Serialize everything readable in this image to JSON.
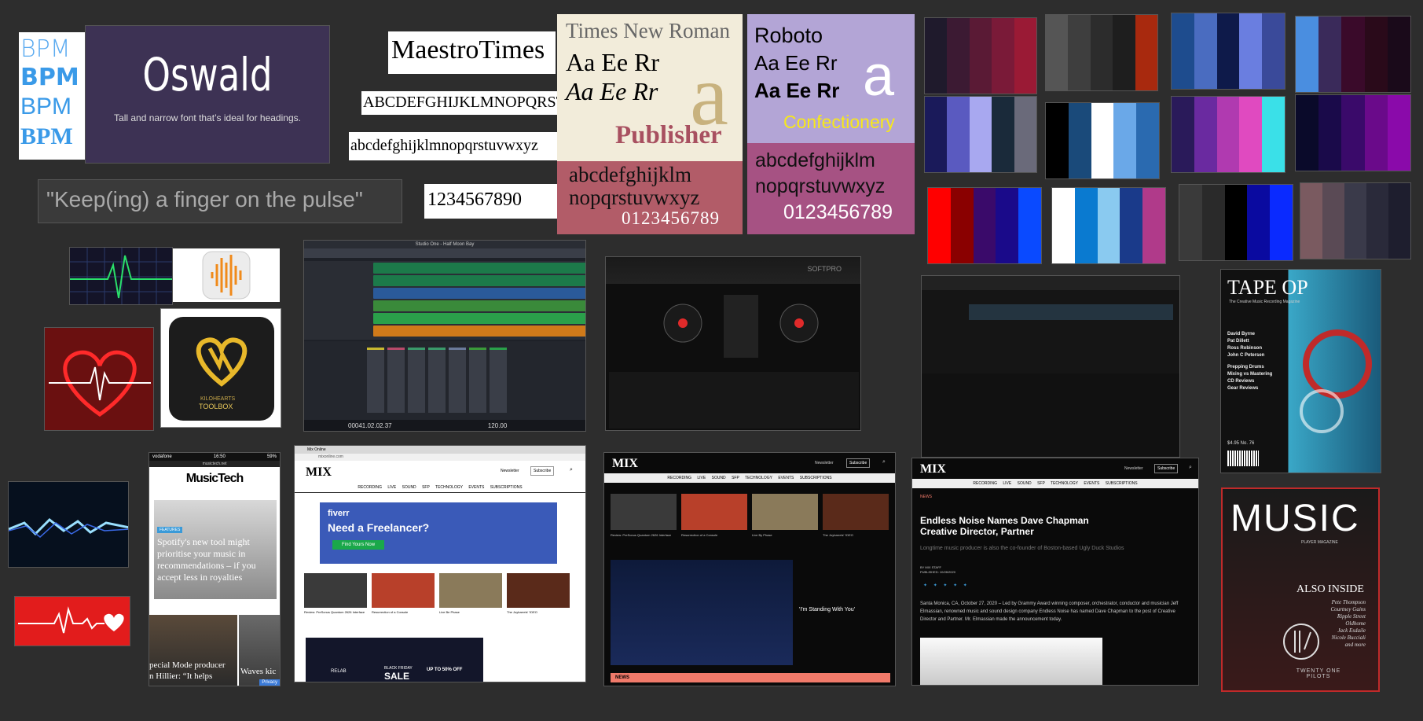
{
  "fonts": {
    "bpm": [
      "BPM",
      "BPM",
      "BPM",
      "BPM"
    ],
    "oswald": {
      "name": "Oswald",
      "desc": "Tall and narrow font that’s ideal for headings."
    },
    "maestro": {
      "name": "MaestroTimes",
      "upper": "ABCDEFGHIJKLMNOPQRST",
      "lower": "abcdefghijklmnopqrstuvwxyz",
      "digits": "1234567890"
    },
    "tagline": "\"Keep(ing) a finger on the pulse\"",
    "times": {
      "name": "Times New Roman",
      "sample1": "Aa Ee Rr",
      "sample2": "Aa Ee Rr",
      "big": "a",
      "role": "Publisher",
      "lower1": "abcdefghijklm",
      "lower2": "nopqrstuvwxyz",
      "digits": "0123456789"
    },
    "roboto": {
      "name": "Roboto",
      "sample1": "Aa Ee Rr",
      "sample2": "Aa Ee Rr",
      "big": "a",
      "role": "Confectionery",
      "lower1": "abcdefghijklm",
      "lower2": "nopqrstuvwxyz",
      "digits": "0123456789"
    }
  },
  "palettes": [
    [
      "#1f1a2c",
      "#3c1a33",
      "#5a1a35",
      "#7a1a38",
      "#9a1a35"
    ],
    [
      "#555555",
      "#3e3e3e",
      "#2c2c2c",
      "#1e1e1e",
      "#a8290e"
    ],
    [
      "#1e4c8e",
      "#4a6cc0",
      "#0e1a4a",
      "#6a7ee0",
      "#3a4a9a"
    ],
    [
      "#4a8ee0",
      "#3a2a5a",
      "#3a0a2a",
      "#2a0a1a",
      "#1a0a1a"
    ],
    [
      "#1a1a5a",
      "#5a5ac0",
      "#a8a8f0",
      "#1a2a3a",
      "#6a6a7a"
    ],
    [
      "#000000",
      "#1a4a7a",
      "#ffffff",
      "#6aa8e8",
      "#2a6ab0"
    ],
    [
      "#2a1a5a",
      "#6a2aa0",
      "#b03ab0",
      "#e04ac0",
      "#3ae0e8"
    ],
    [
      "#0a0a2a",
      "#1a0a4a",
      "#3a0a6a",
      "#6a0a8a",
      "#8a0aaa"
    ],
    [
      "#ff0000",
      "#8a0000",
      "#3a0a6a",
      "#1a0a8a",
      "#0a4aff"
    ],
    [
      "#ffffff",
      "#0a7ad0",
      "#8acaf0",
      "#1a3a8a",
      "#b03a8a"
    ],
    [
      "#3a3a3a",
      "#2a2a2a",
      "#000000",
      "#0a0aa0",
      "#0a2aff"
    ],
    [
      "#7a5a60",
      "#5a4a55",
      "#3a3a4a",
      "#2a2a3a",
      "#1e1e2e"
    ]
  ],
  "daw": {
    "title": "Studio One - Half Moon Bay",
    "time": "00041.02.02.37",
    "tempo": "120.00",
    "tracks": [
      "Piano",
      "Strings 1",
      "Strings 2",
      "Cello",
      "Bass Strings",
      "Low"
    ]
  },
  "dj": {
    "brand": "SOFTPRO"
  },
  "tapeop": {
    "logo": "TAPE OP",
    "tagline": "The Creative Music Recording Magazine",
    "names": [
      "David Byrne",
      "Pat Dillett",
      "Ross Robinson",
      "John C Petersen"
    ],
    "items": [
      "Prepping Drums",
      "Mixing vs Mastering",
      "CD Reviews",
      "Gear Reviews"
    ],
    "price": "$4.95 No. 76"
  },
  "musicmag": {
    "title": "MUSIC",
    "sub": "PLAYER MAGAZINE",
    "also": "ALSO INSIDE",
    "names": [
      "Pete Thompson",
      "Courtney Gains",
      "Ripple Street",
      "Oldhome",
      "Jack Esdaile",
      "Nicole Bucciali",
      "and more"
    ],
    "band": "TWENTY ONE PILOTS"
  },
  "mobile": {
    "carrier": "vodafone",
    "time": "16:50",
    "battery": "59%",
    "url": "musictech.net",
    "brand": "MusicTech",
    "tag": "FEATURES",
    "headline": "Spotify's new tool might prioritise your music in recommendations – if you accept less in royalties",
    "sub1": "pecial Mode producer",
    "sub2": "n Hillier: “It helps",
    "sub3": "Waves kic",
    "privacy": "Privacy"
  },
  "mix1": {
    "browser_tab": "Mix Online",
    "url": "mixonline.com",
    "logo": "MIX",
    "nav": [
      "RECORDING",
      "LIVE SOUND",
      "SFP",
      "TECHNOLOGY",
      "EVENTS",
      "SUBSCRIPTIONS"
    ],
    "newsletter": "Newsletter",
    "subscribe": "Subscribe",
    "ad_brand": "fiverr",
    "ad_head": "Need a Freelancer?",
    "ad_cta": "Find Yours Now",
    "captions": [
      "Review: PreSonus Quantum 2626 Interface",
      "Resurrection of a Console",
      "Live Be Phase",
      "The Joybarrels' 'IDEO"
    ],
    "sale1": "BLACK FRIDAY",
    "sale2": "SALE",
    "sale3": "UP TO 50% OFF",
    "ad_logo": "RELAB"
  },
  "mix2": {
    "logo": "MIX",
    "nav": [
      "RECORDING",
      "LIVE SOUND",
      "SFP",
      "TECHNOLOGY",
      "EVENTS",
      "SUBSCRIPTIONS"
    ],
    "newsletter": "Newsletter",
    "subscribe": "Subscribe",
    "captions": [
      "Review: PreSonus Quantum 2626 Interface",
      "Resurrection of a Console",
      "Live By Phase",
      "The Joybarrels' 'IDEO"
    ],
    "feature": "'I'm Standing With You'",
    "news": "NEWS"
  },
  "mix3": {
    "logo": "MIX",
    "nav": [
      "RECORDING",
      "LIVE SOUND",
      "SFP",
      "TECHNOLOGY",
      "EVENTS",
      "SUBSCRIPTIONS"
    ],
    "newsletter": "Newsletter",
    "subscribe": "Subscribe",
    "crumb": "NEWS",
    "headline1": "Endless Noise Names Dave Chapman",
    "headline2": "Creative Director, Partner",
    "deck": "Longtime music producer is also the co-founder of Boston-based Ugly Duck Studios",
    "by": "BY MIX STAFF",
    "date": "PUBLISHED: 10/28/2020",
    "body": "Santa Monica, CA, October 27, 2020 – Led by Grammy Award winning composer, orchestrator, conductor and musician Jeff Elmassian, renowned music and sound design company Endless Noise has named Dave Chapman to the post of Creative Director and Partner. Mr. Elmassian made the announcement today."
  }
}
